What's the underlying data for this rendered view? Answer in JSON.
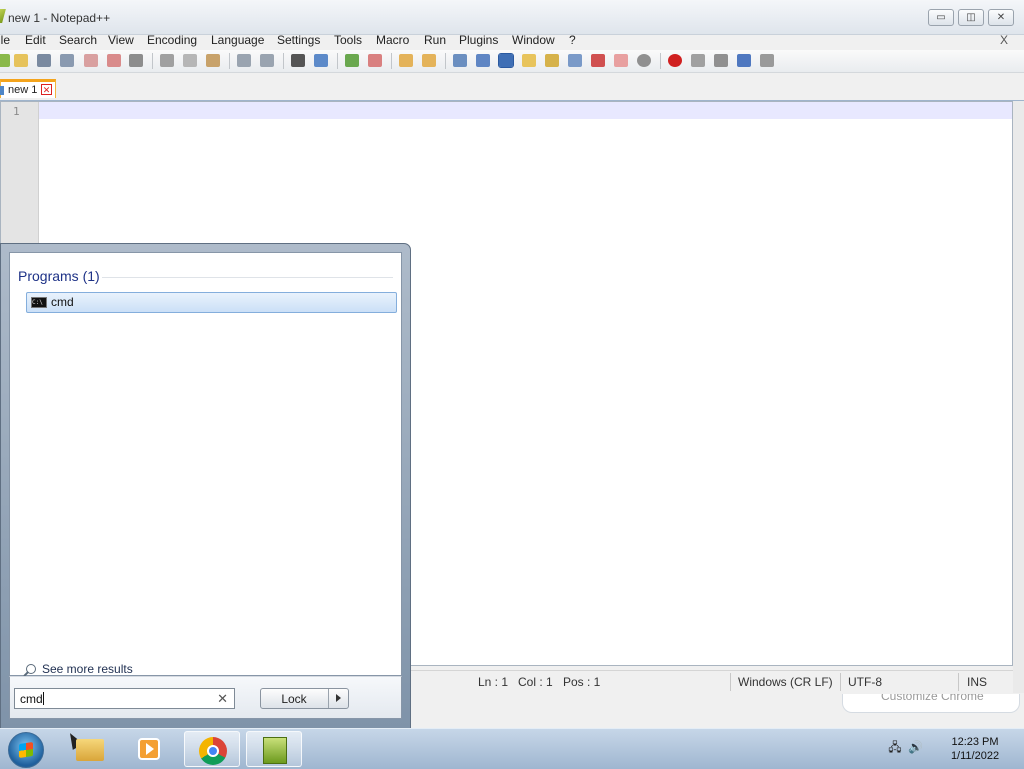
{
  "window": {
    "title": "new 1 - Notepad++",
    "controls": {
      "minimize": "▭",
      "restore": "◫",
      "close": "✕"
    }
  },
  "menu": {
    "items": [
      "ile",
      "Edit",
      "Search",
      "View",
      "Encoding",
      "Language",
      "Settings",
      "Tools",
      "Macro",
      "Run",
      "Plugins",
      "Window",
      "?"
    ],
    "close": "X"
  },
  "tabs": [
    {
      "label": "new 1",
      "close": "✕"
    }
  ],
  "editor": {
    "line_numbers": [
      "1"
    ],
    "content": ""
  },
  "statusbar": {
    "ln": "Ln : 1",
    "col": "Col : 1",
    "pos": "Pos : 1",
    "eol": "Windows (CR LF)",
    "encoding": "UTF-8",
    "mode": "INS"
  },
  "notification": {
    "text": "Customize Chrome"
  },
  "start_menu": {
    "results_heading": "Programs (1)",
    "results": [
      {
        "label": "cmd",
        "icon": "cmd-icon"
      }
    ],
    "see_more": "See more results",
    "search_value": "cmd",
    "search_clear": "✕",
    "power_button": "Lock"
  },
  "taskbar": {
    "apps": [
      "windows-explorer",
      "media-player",
      "chrome",
      "notepad-plus-plus"
    ],
    "tray": {
      "network": "🖧",
      "volume": "🔊"
    },
    "clock": {
      "time": "12:23 PM",
      "date": "1/11/2022"
    }
  },
  "colors": {
    "current_line": "#e8e8ff",
    "tab_accent": "#f4a41c",
    "results_heading": "#1e3287"
  }
}
